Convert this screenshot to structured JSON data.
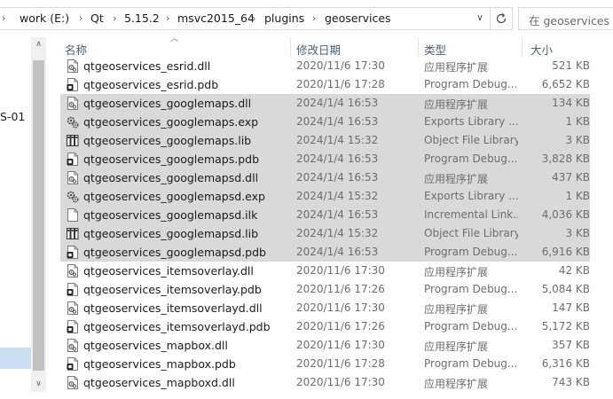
{
  "address_bar": {
    "breadcrumbs": [
      "work (E:)",
      "Qt",
      "5.15.2",
      "msvc2015_64",
      "plugins",
      "geoservices"
    ],
    "search_placeholder": "在 geoservices 中"
  },
  "nav_pane": {
    "partial_label": "S-01"
  },
  "columns": {
    "name": "名称",
    "date": "修改日期",
    "type": "类型",
    "size": "大小"
  },
  "files": [
    {
      "name": "qtgeoservices_esrid.dll",
      "date": "2020/11/6 17:30",
      "type": "应用程序扩展",
      "size": "521 KB",
      "icon": "dll-icon",
      "selected": false
    },
    {
      "name": "qtgeoservices_esrid.pdb",
      "date": "2020/11/6 17:28",
      "type": "Program Debug...",
      "size": "6,652 KB",
      "icon": "pdb-icon",
      "selected": false
    },
    {
      "name": "qtgeoservices_googlemaps.dll",
      "date": "2024/1/4 16:53",
      "type": "应用程序扩展",
      "size": "134 KB",
      "icon": "dll-icon",
      "selected": true
    },
    {
      "name": "qtgeoservices_googlemaps.exp",
      "date": "2024/1/4 16:53",
      "type": "Exports Library ...",
      "size": "1 KB",
      "icon": "exp-icon",
      "selected": true
    },
    {
      "name": "qtgeoservices_googlemaps.lib",
      "date": "2024/1/4 15:32",
      "type": "Object File Library",
      "size": "3 KB",
      "icon": "lib-icon",
      "selected": true
    },
    {
      "name": "qtgeoservices_googlemaps.pdb",
      "date": "2024/1/4 16:53",
      "type": "Program Debug...",
      "size": "3,828 KB",
      "icon": "pdb-icon",
      "selected": true
    },
    {
      "name": "qtgeoservices_googlemapsd.dll",
      "date": "2024/1/4 16:53",
      "type": "应用程序扩展",
      "size": "437 KB",
      "icon": "dll-icon",
      "selected": true
    },
    {
      "name": "qtgeoservices_googlemapsd.exp",
      "date": "2024/1/4 15:32",
      "type": "Exports Library ...",
      "size": "1 KB",
      "icon": "exp-icon",
      "selected": true
    },
    {
      "name": "qtgeoservices_googlemapsd.ilk",
      "date": "2024/1/4 16:53",
      "type": "Incremental Link...",
      "size": "4,036 KB",
      "icon": "ilk-icon",
      "selected": true
    },
    {
      "name": "qtgeoservices_googlemapsd.lib",
      "date": "2024/1/4 15:32",
      "type": "Object File Library",
      "size": "3 KB",
      "icon": "lib-icon",
      "selected": true
    },
    {
      "name": "qtgeoservices_googlemapsd.pdb",
      "date": "2024/1/4 16:53",
      "type": "Program Debug...",
      "size": "6,916 KB",
      "icon": "pdb-icon",
      "selected": true
    },
    {
      "name": "qtgeoservices_itemsoverlay.dll",
      "date": "2020/11/6 17:30",
      "type": "应用程序扩展",
      "size": "42 KB",
      "icon": "dll-icon",
      "selected": false
    },
    {
      "name": "qtgeoservices_itemsoverlay.pdb",
      "date": "2020/11/6 17:26",
      "type": "Program Debug...",
      "size": "5,084 KB",
      "icon": "pdb-icon",
      "selected": false
    },
    {
      "name": "qtgeoservices_itemsoverlayd.dll",
      "date": "2020/11/6 17:30",
      "type": "应用程序扩展",
      "size": "147 KB",
      "icon": "dll-icon",
      "selected": false
    },
    {
      "name": "qtgeoservices_itemsoverlayd.pdb",
      "date": "2020/11/6 17:26",
      "type": "Program Debug...",
      "size": "5,172 KB",
      "icon": "pdb-icon",
      "selected": false
    },
    {
      "name": "qtgeoservices_mapbox.dll",
      "date": "2020/11/6 17:30",
      "type": "应用程序扩展",
      "size": "357 KB",
      "icon": "dll-icon",
      "selected": false
    },
    {
      "name": "qtgeoservices_mapbox.pdb",
      "date": "2020/11/6 17:28",
      "type": "Program Debug...",
      "size": "6,316 KB",
      "icon": "pdb-icon",
      "selected": false
    },
    {
      "name": "qtgeoservices_mapboxd.dll",
      "date": "2020/11/6 17:30",
      "type": "应用程序扩展",
      "size": "743 KB",
      "icon": "dll-icon",
      "selected": false
    }
  ]
}
